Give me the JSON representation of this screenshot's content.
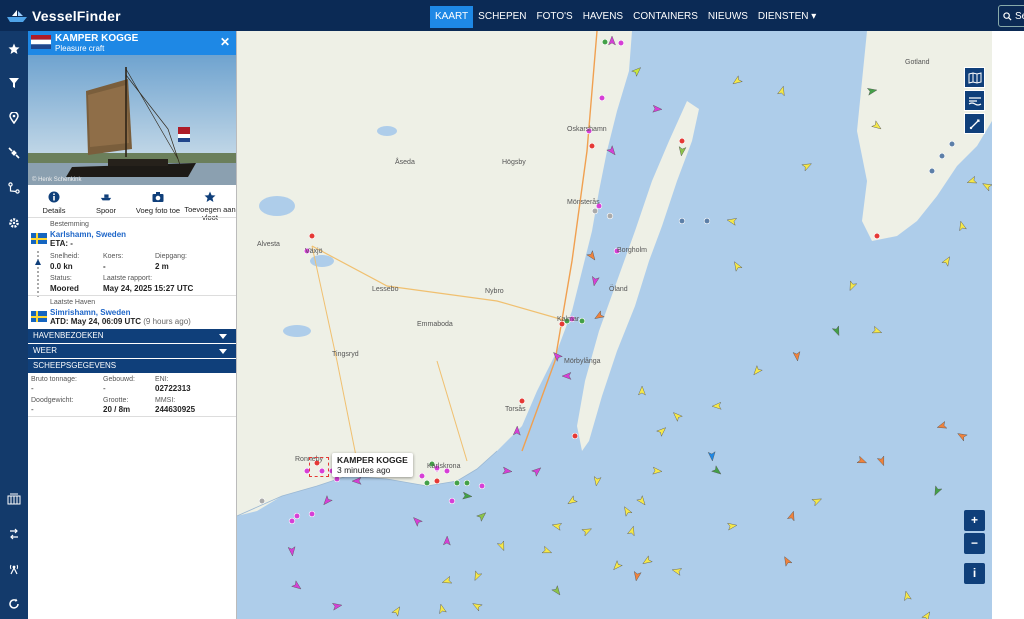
{
  "brand": {
    "name": "VesselFinder"
  },
  "nav": [
    {
      "label": "KAART",
      "active": true
    },
    {
      "label": "SCHEPEN"
    },
    {
      "label": "FOTO'S"
    },
    {
      "label": "HAVENS"
    },
    {
      "label": "CONTAINERS"
    },
    {
      "label": "NIEUWS"
    },
    {
      "label": "DIENSTEN"
    }
  ],
  "search": {
    "label": "Se"
  },
  "rail_icons": [
    "star-icon",
    "filter-icon",
    "location-pin-icon",
    "satellite-icon",
    "route-icon",
    "gear-icon",
    "port-icon",
    "sync-route-icon",
    "antenna-icon",
    "refresh-icon"
  ],
  "vessel": {
    "name": "KAMPER KOGGE",
    "type": "Pleasure craft",
    "photo_credit": "© Henk Schenkink",
    "actions": {
      "details": "Details",
      "track": "Spoor",
      "add_photo": "Voeg foto toe",
      "add_fleet": "Toevoegen aan vloot"
    },
    "destination_label": "Bestemming",
    "destination": "Karlshamn, Sweden",
    "eta": "ETA: -",
    "speed_label": "Snelheid:",
    "speed": "0.0 kn",
    "course_label": "Koers:",
    "course": "-",
    "draught_label": "Diepgang:",
    "draught": "2 m",
    "status_label": "Status:",
    "status": "Moored",
    "last_report_label": "Laatste rapport:",
    "last_report": "May 24, 2025 15:27 UTC",
    "last_port_label": "Laatste Haven",
    "last_port": "Simrishamn, Sweden",
    "atd": "ATD: May 24, 06:09 UTC",
    "atd_ago": "(9 hours ago)",
    "port_calls_label": "HAVENBEZOEKEN",
    "weather_label": "WEER",
    "particulars_label": "SCHEEPSGEGEVENS",
    "gross_tonnage_label": "Bruto tonnage:",
    "gross_tonnage": "-",
    "built_label": "Gebouwd:",
    "built": "-",
    "eni_label": "ENI:",
    "eni": "02722313",
    "deadweight_label": "Doodgewicht:",
    "deadweight": "-",
    "size_label": "Grootte:",
    "size": "20 / 8m",
    "mmsi_label": "MMSI:",
    "mmsi": "244630925"
  },
  "map": {
    "tooltip_title": "KAMPER KOGGE",
    "tooltip_time": "3 minutes ago",
    "places": [
      "Växjö",
      "Karlskrona",
      "Kalmar",
      "Öland",
      "Gotland",
      "Nybro",
      "Emmaboda",
      "Tingsryd",
      "Lessebo",
      "Mönsterås",
      "Oskarshamn",
      "Ronneby",
      "Borgholm",
      "Mörbylånga",
      "Alvesta",
      "Åseda",
      "Högsby",
      "Torsås"
    ],
    "zoom_in": "+",
    "zoom_out": "−",
    "info": "i"
  },
  "colors": {
    "topbar": "#0b2a55",
    "accent": "#1e88e5",
    "rail": "#133a6b",
    "water": "#aecdea",
    "land": "#eef0e6"
  }
}
